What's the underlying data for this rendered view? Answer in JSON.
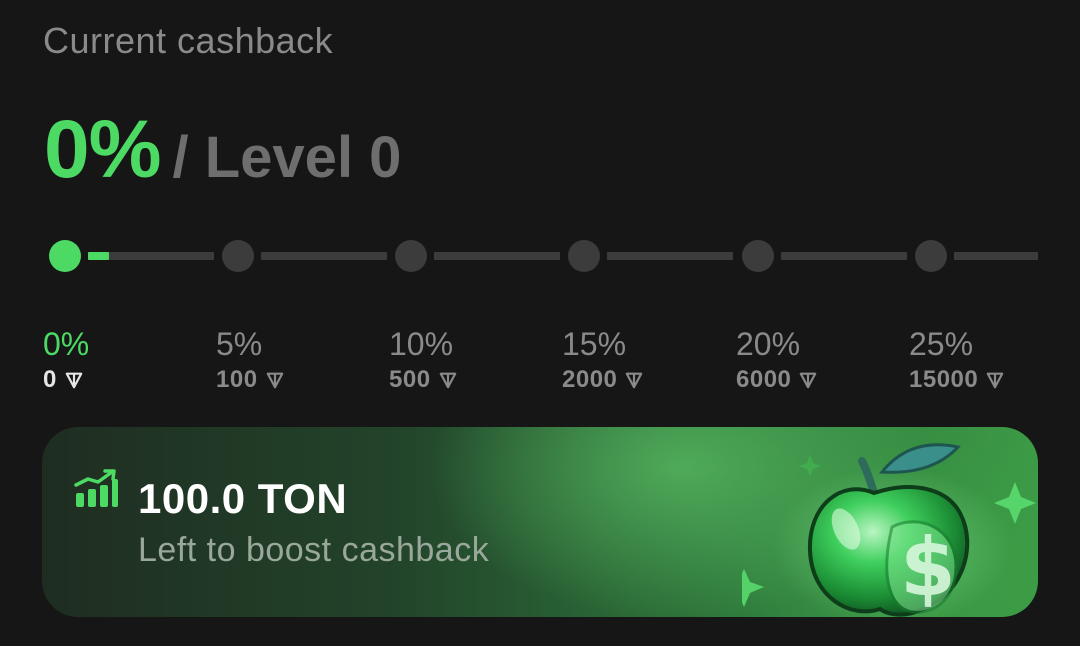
{
  "header": {
    "title": "Current cashback",
    "current_percent": "0%",
    "level_text": "/ Level 0"
  },
  "progress": {
    "current_level": 0,
    "fill_fraction_of_first_segment": 0.17,
    "levels": [
      {
        "percent": "0%",
        "threshold": "0",
        "active": true
      },
      {
        "percent": "5%",
        "threshold": "100",
        "active": false
      },
      {
        "percent": "10%",
        "threshold": "500",
        "active": false
      },
      {
        "percent": "15%",
        "threshold": "2000",
        "active": false
      },
      {
        "percent": "20%",
        "threshold": "6000",
        "active": false
      },
      {
        "percent": "25%",
        "threshold": "15000",
        "active": false
      }
    ],
    "currency_icon": "ton-icon"
  },
  "banner": {
    "amount": "100.0 TON",
    "subtitle": "Left to boost cashback",
    "icon": "chart-up-icon",
    "illustration": "green-apple-dollar-illustration"
  },
  "colors": {
    "accent": "#4cd964",
    "background": "#161616",
    "muted": "#8a8a8a",
    "track": "#3c3c3c"
  }
}
